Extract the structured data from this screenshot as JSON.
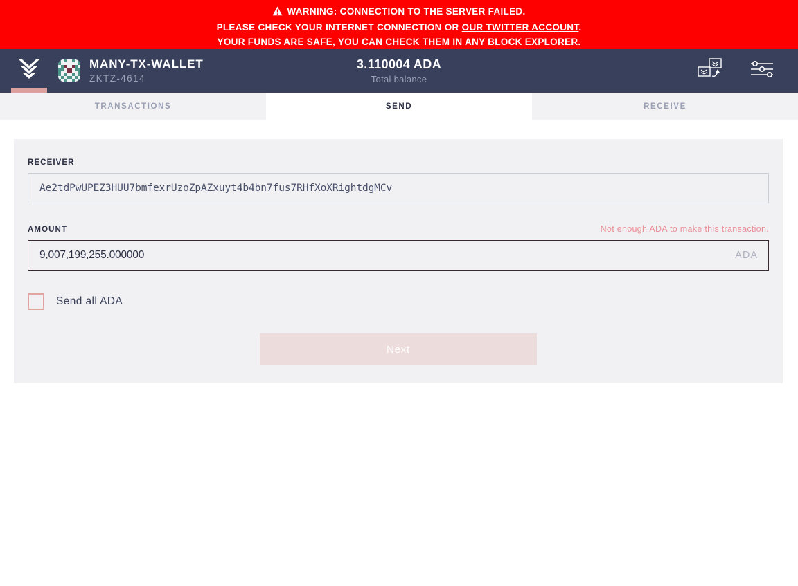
{
  "banner": {
    "icon": "warning-triangle-icon",
    "line1": "WARNING: CONNECTION TO THE SERVER FAILED.",
    "line2_prefix": "PLEASE CHECK YOUR INTERNET CONNECTION OR ",
    "line2_link": "OUR TWITTER ACCOUNT",
    "line2_suffix": ".",
    "line3": "YOUR FUNDS ARE SAFE, YOU CAN CHECK THEM IN ANY BLOCK EXPLORER.",
    "background_color": "#ff0000",
    "text_color": "#ffffff"
  },
  "topbar": {
    "logo_icon": "daedalus-chevron-logo-icon",
    "accent_color": "#d9a29c",
    "wallet": {
      "avatar_icon": "wallet-identicon-avatar",
      "name": "MANY-TX-WALLET",
      "id": "ZKTZ-4614"
    },
    "balance": {
      "amount": "3.110004 ADA",
      "label": "Total balance"
    },
    "actions": {
      "wallet_switch_icon": "wallet-transfer-icon",
      "settings_icon": "sliders-settings-icon"
    },
    "background_color": "#38405c"
  },
  "tabs": [
    {
      "id": "transactions",
      "label": "TRANSACTIONS",
      "active": false
    },
    {
      "id": "send",
      "label": "SEND",
      "active": true
    },
    {
      "id": "receive",
      "label": "RECEIVE",
      "active": false
    }
  ],
  "send_form": {
    "receiver": {
      "label": "RECEIVER",
      "value": "Ae2tdPwUPEZ3HUU7bmfexrUzoZpAZxuyt4b4bn7fus7RHfXoXRightdgMCv",
      "placeholder": ""
    },
    "amount": {
      "label": "AMOUNT",
      "value": "9,007,199,255.000000",
      "suffix": "ADA",
      "error": "Not enough ADA to make this transaction.",
      "error_color": "#ea8f96",
      "placeholder": ""
    },
    "send_all": {
      "label": "Send all ADA",
      "checked": false,
      "border_color": "#e0a59e"
    },
    "next_button": {
      "label": "Next",
      "disabled": true,
      "background_color": "#ecdcdb"
    }
  }
}
